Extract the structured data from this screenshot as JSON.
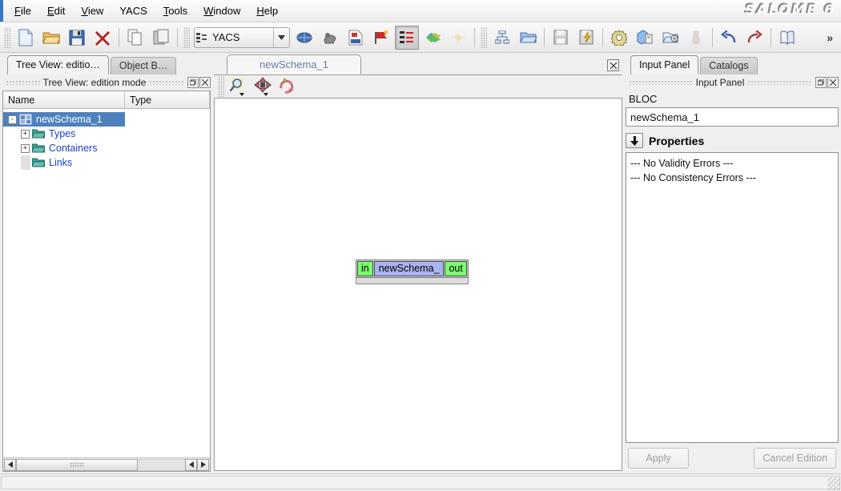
{
  "window": {
    "logo": "SALOME 6"
  },
  "menubar": {
    "items": [
      {
        "label": "File",
        "accel": "F"
      },
      {
        "label": "Edit",
        "accel": "E"
      },
      {
        "label": "View",
        "accel": "V"
      },
      {
        "label": "YACS",
        "accel": ""
      },
      {
        "label": "Tools",
        "accel": "T"
      },
      {
        "label": "Window",
        "accel": "W"
      },
      {
        "label": "Help",
        "accel": "H"
      }
    ]
  },
  "toolbar": {
    "module_combo": {
      "value": "YACS",
      "icon": "yacs-schema-icon"
    },
    "overflow_label": "»",
    "buttons": [
      {
        "name": "new-document-button",
        "icon": "new-document-icon"
      },
      {
        "name": "open-document-button",
        "icon": "open-folder-icon"
      },
      {
        "name": "save-document-button",
        "icon": "floppy-save-icon"
      },
      {
        "name": "delete-button",
        "icon": "red-x-delete-icon"
      },
      {
        "name": "copy-button",
        "icon": "copy-icon"
      },
      {
        "name": "paste-button",
        "icon": "paste-icon"
      },
      {
        "name": "mesh-module-button",
        "icon": "globe-blue-icon"
      },
      {
        "name": "import-button",
        "icon": "import-grey-icon"
      },
      {
        "name": "med-file-button",
        "icon": "med-file-icon"
      },
      {
        "name": "flag-button",
        "icon": "red-flag-icon"
      },
      {
        "name": "new-schema-button",
        "icon": "schema-icon",
        "pressed": true
      },
      {
        "name": "run-schema-button",
        "icon": "colored-fan-icon"
      },
      {
        "name": "sun-button",
        "icon": "sun-icon"
      },
      {
        "name": "tree-schema-button",
        "icon": "tree-nodes-icon"
      },
      {
        "name": "open-schema-button",
        "icon": "open-blue-folder-icon"
      },
      {
        "name": "save-schema-button",
        "icon": "floppy-grey-icon"
      },
      {
        "name": "save-run-button",
        "icon": "floppy-lightning-icon"
      },
      {
        "name": "settings-gear-button",
        "icon": "gear-icon"
      },
      {
        "name": "container-button",
        "icon": "container-icon"
      },
      {
        "name": "folder-gear-button",
        "icon": "folder-gear-icon"
      },
      {
        "name": "dump-state-button",
        "icon": "snowman-grey-icon"
      },
      {
        "name": "undo-button",
        "icon": "undo-arrow-icon"
      },
      {
        "name": "redo-button",
        "icon": "redo-arrow-icon"
      },
      {
        "name": "book-button",
        "icon": "book-icon"
      }
    ]
  },
  "left_panel": {
    "tabs": [
      {
        "label": "Tree View: editio…",
        "active": true
      },
      {
        "label": "Object B…",
        "active": false
      }
    ],
    "dock_title": "Tree View: edition mode",
    "columns": [
      "Name",
      "Type"
    ],
    "tree": [
      {
        "label": "newSchema_1",
        "indent": 0,
        "expander": "-",
        "selected": true,
        "icon": "schema-root-icon"
      },
      {
        "label": "Types",
        "indent": 1,
        "expander": "+",
        "selected": false,
        "icon": "folder-teal-icon"
      },
      {
        "label": "Containers",
        "indent": 1,
        "expander": "+",
        "selected": false,
        "icon": "folder-teal-icon"
      },
      {
        "label": "Links",
        "indent": 1,
        "expander": "",
        "selected": false,
        "icon": "folder-teal-icon"
      }
    ]
  },
  "center": {
    "tab_label": "newSchema_1",
    "view_buttons": [
      {
        "name": "zoom-tool-button",
        "icon": "magnifier-icon",
        "has_caret": true
      },
      {
        "name": "pan-tool-button",
        "icon": "move-arrows-icon",
        "has_caret": true
      },
      {
        "name": "reset-view-button",
        "icon": "rotate-reset-icon",
        "has_caret": false
      }
    ],
    "node": {
      "in_port": "in",
      "title": "newSchema_",
      "out_port": "out",
      "body_color": "#aab4ef",
      "port_color": "#7cfc70"
    }
  },
  "right_panel": {
    "tabs": [
      {
        "label": "Input Panel",
        "active": true
      },
      {
        "label": "Catalogs",
        "active": false
      }
    ],
    "dock_title": "Input Panel",
    "type_label": "BLOC",
    "name_value": "newSchema_1",
    "properties_title": "Properties",
    "properties_toggle_icon": "arrow-down-icon",
    "messages": [
      "--- No Validity Errors ---",
      "--- No Consistency Errors ---"
    ],
    "apply_label": "Apply",
    "cancel_label": "Cancel Edition"
  },
  "statusbar": {
    "text": ""
  },
  "colors": {
    "selection": "#4f81bd",
    "tree_link": "#1a3fd0",
    "node_body": "#aab4ef",
    "node_port": "#7cfc70",
    "accent_blue": "#3a76c4"
  }
}
